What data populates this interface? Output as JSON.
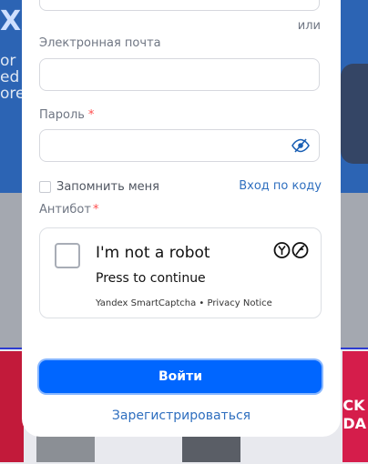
{
  "background": {
    "big_text": "X",
    "side_text": [
      "or",
      "ed",
      "ore"
    ],
    "promo_text": [
      "CK",
      "DA"
    ]
  },
  "form": {
    "or_label": "или",
    "email_label": "Электронная почта",
    "email_value": "",
    "password_label": "Пароль",
    "password_required_mark": "*",
    "password_value": "",
    "remember_label": "Запомнить меня",
    "code_login_link": "Вход по коду",
    "antibot_label": "Антибот",
    "antibot_required_mark": "*"
  },
  "captcha": {
    "title": "I'm not a robot",
    "subtitle": "Press to continue",
    "footer": "Yandex SmartCaptcha • Privacy Notice",
    "checked": false
  },
  "actions": {
    "login_button": "Войти",
    "register_link": "Зарегистрироваться"
  },
  "colors": {
    "primary": "#0066ff",
    "link": "#2f6fbf",
    "required": "#ff4d4d"
  }
}
